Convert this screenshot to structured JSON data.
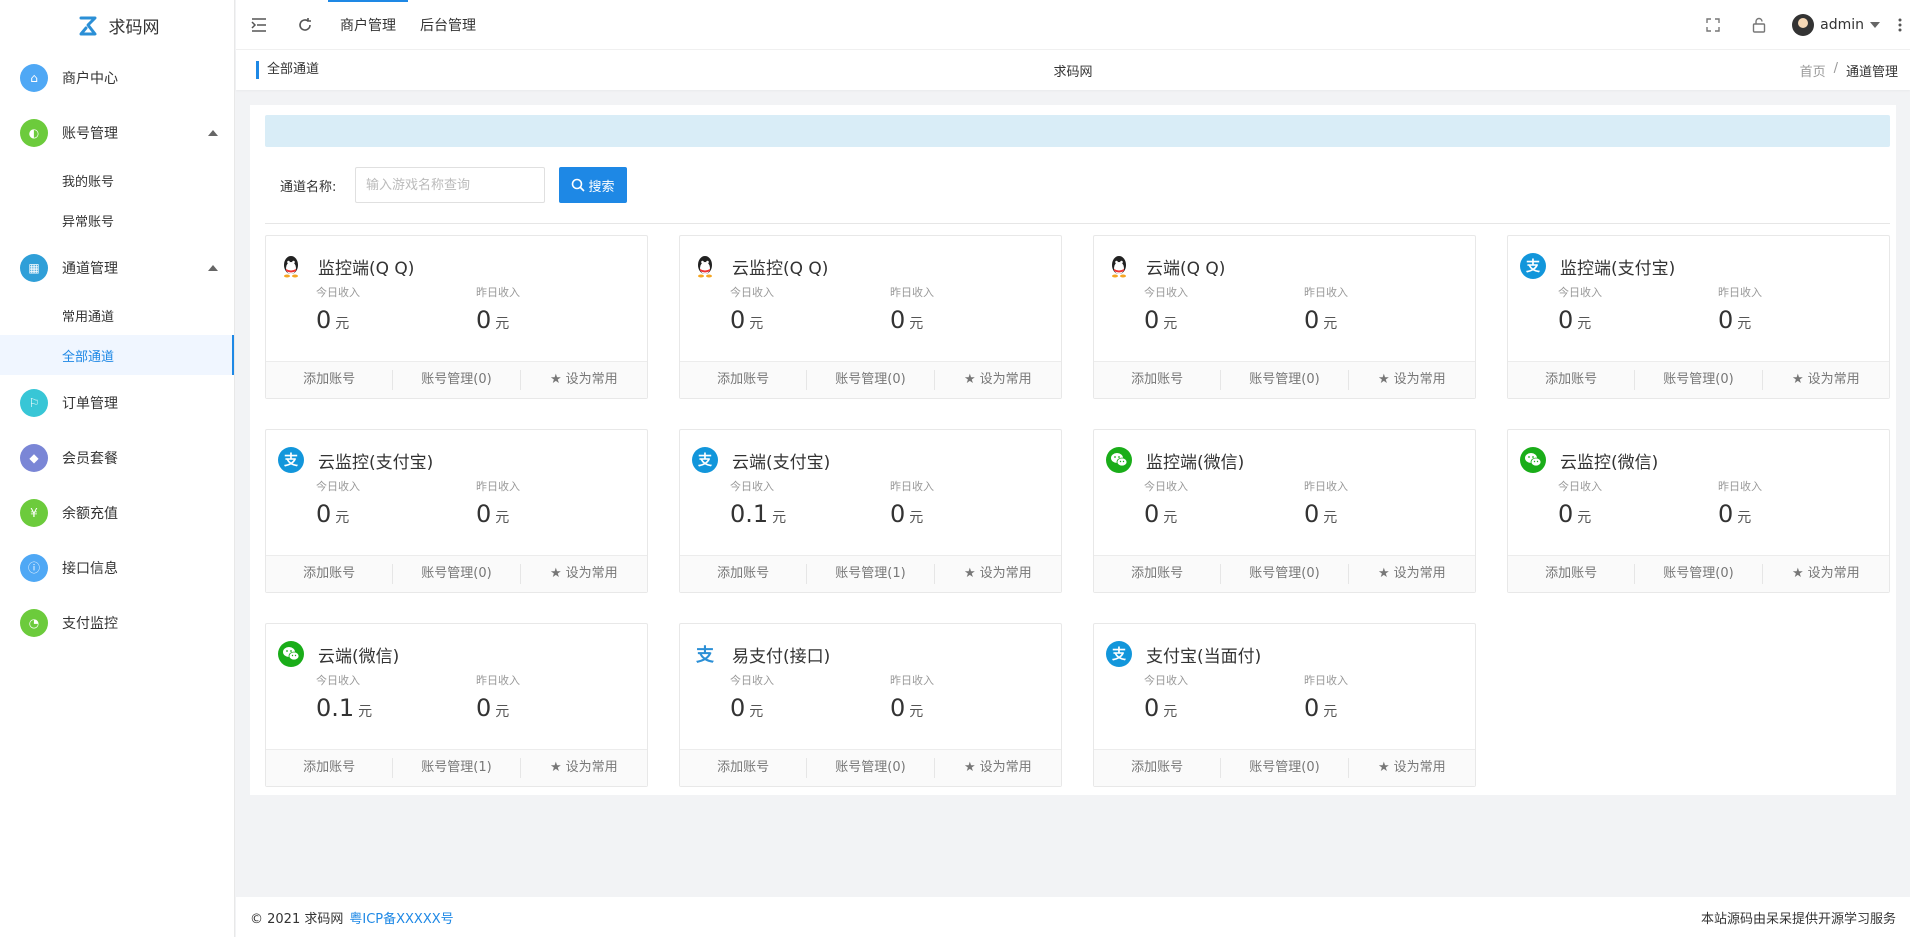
{
  "app": {
    "logo_text": "求码网"
  },
  "sidebar": {
    "items": [
      {
        "label": "商户中心",
        "color": "#4fa8f5",
        "icon": "home-icon"
      },
      {
        "label": "账号管理",
        "color": "#6ccb3c",
        "icon": "user-icon",
        "expanded": true,
        "children": [
          "我的账号",
          "异常账号"
        ]
      },
      {
        "label": "通道管理",
        "color": "#2f9fd8",
        "icon": "channel-icon",
        "expanded": true,
        "children": [
          "常用通道",
          "全部通道"
        ],
        "active_child": "全部通道"
      },
      {
        "label": "订单管理",
        "color": "#38c6d6",
        "icon": "cart-icon"
      },
      {
        "label": "会员套餐",
        "color": "#7a86d6",
        "icon": "gem-icon"
      },
      {
        "label": "余额充值",
        "color": "#6ccb3c",
        "icon": "yen-icon"
      },
      {
        "label": "接口信息",
        "color": "#4fa8f5",
        "icon": "info-icon"
      },
      {
        "label": "支付监控",
        "color": "#6ccb3c",
        "icon": "gauge-icon"
      }
    ]
  },
  "header": {
    "tabs": [
      "商户管理",
      "后台管理"
    ],
    "active_tab": "商户管理",
    "user": "admin"
  },
  "breadcrumb": {
    "title": "全部通道",
    "center": "求码网",
    "path": [
      "首页",
      "/",
      "通道管理"
    ]
  },
  "search": {
    "label": "通道名称:",
    "placeholder": "输入游戏名称查询",
    "button": "搜索"
  },
  "card_labels": {
    "today": "今日收入",
    "yesterday": "昨日收入",
    "unit": "元",
    "add": "添加账号",
    "favorite": "设为常用"
  },
  "channels": [
    {
      "name": "监控端(Q Q)",
      "type": "qq",
      "today": "0",
      "yesterday": "0",
      "manage": "账号管理(0)"
    },
    {
      "name": "云监控(Q Q)",
      "type": "qq",
      "today": "0",
      "yesterday": "0",
      "manage": "账号管理(0)"
    },
    {
      "name": "云端(Q Q)",
      "type": "qq",
      "today": "0",
      "yesterday": "0",
      "manage": "账号管理(0)"
    },
    {
      "name": "监控端(支付宝)",
      "type": "ali",
      "today": "0",
      "yesterday": "0",
      "manage": "账号管理(0)"
    },
    {
      "name": "云监控(支付宝)",
      "type": "ali",
      "today": "0",
      "yesterday": "0",
      "manage": "账号管理(0)"
    },
    {
      "name": "云端(支付宝)",
      "type": "ali",
      "today": "0.1",
      "yesterday": "0",
      "manage": "账号管理(1)"
    },
    {
      "name": "监控端(微信)",
      "type": "wx",
      "today": "0",
      "yesterday": "0",
      "manage": "账号管理(0)"
    },
    {
      "name": "云监控(微信)",
      "type": "wx",
      "today": "0",
      "yesterday": "0",
      "manage": "账号管理(0)"
    },
    {
      "name": "云端(微信)",
      "type": "wx",
      "today": "0.1",
      "yesterday": "0",
      "manage": "账号管理(1)"
    },
    {
      "name": "易支付(接口)",
      "type": "yi",
      "today": "0",
      "yesterday": "0",
      "manage": "账号管理(0)"
    },
    {
      "name": "支付宝(当面付)",
      "type": "ali",
      "today": "0",
      "yesterday": "0",
      "manage": "账号管理(0)"
    }
  ],
  "footer": {
    "copyright": "© 2021 求码网",
    "icp": "粤ICP备XXXXX号",
    "right": "本站源码由呆呆提供开源学习服务"
  }
}
